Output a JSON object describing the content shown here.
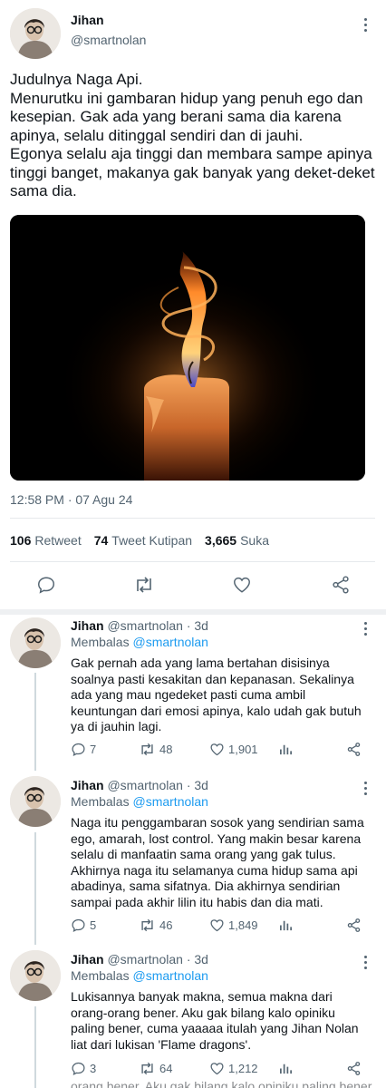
{
  "main_tweet": {
    "name": "Jihan",
    "handle": "@smartnolan",
    "text": "Judulnya Naga Api.\nMenurutku ini gambaran hidup yang penuh ego dan kesepian. Gak ada yang berani sama dia karena apinya, selalu ditinggal sendiri dan di jauhi.\nEgonya selalu aja tinggi dan membara sampe apinya tinggi banget, makanya gak banyak yang deket-deket sama dia.",
    "timestamp": "12:58 PM · 07 Agu 24",
    "stats": {
      "retweets": "106",
      "retweets_label": "Retweet",
      "quotes": "74",
      "quotes_label": "Tweet Kutipan",
      "likes": "3,665",
      "likes_label": "Suka"
    },
    "actions": [
      "reply-icon",
      "retweet-icon",
      "like-icon",
      "share-icon"
    ]
  },
  "replies": [
    {
      "name": "Jihan",
      "handle": "@smartnolan",
      "time": "3d",
      "replying_label": "Membalas",
      "replying_to": "@smartnolan",
      "text": "Gak pernah ada yang lama bertahan disisinya soalnya pasti kesakitan dan kepanasan. Sekalinya ada yang mau ngedeket pasti cuma ambil keuntungan dari emosi apinya, kalo udah gak butuh ya di jauhin lagi.",
      "replies": "7",
      "retweets": "48",
      "likes": "1,901"
    },
    {
      "name": "Jihan",
      "handle": "@smartnolan",
      "time": "3d",
      "replying_label": "Membalas",
      "replying_to": "@smartnolan",
      "text": "Naga itu penggambaran sosok yang sendirian sama ego, amarah, lost control. Yang makin besar karena selalu di manfaatin sama orang yang gak tulus. Akhirnya naga itu selamanya cuma hidup sama api abadinya, sama sifatnya. Dia akhirnya sendirian sampai pada akhir lilin itu habis dan dia mati.",
      "replies": "5",
      "retweets": "46",
      "likes": "1,849"
    },
    {
      "name": "Jihan",
      "handle": "@smartnolan",
      "time": "3d",
      "replying_label": "Membalas",
      "replying_to": "@smartnolan",
      "text": "Lukisannya banyak makna, semua makna dari orang-orang bener. Aku gak bilang kalo opiniku paling bener, cuma yaaaaa itulah yang Jihan Nolan liat dari lukisan 'Flame dragons'.",
      "replies": "3",
      "retweets": "64",
      "likes": "1,212"
    }
  ],
  "cutoff_text": "orang bener. Aku gak bilang kalo opiniku paling bener,",
  "colors": {
    "link": "#1d9bf0",
    "muted": "#536471",
    "text": "#0f1419",
    "divider": "#e6e9ec"
  }
}
